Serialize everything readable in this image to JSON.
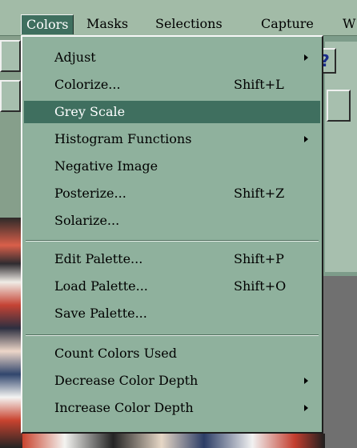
{
  "menubar": {
    "items": [
      {
        "label": "Colors"
      },
      {
        "label": "Masks"
      },
      {
        "label": "Selections"
      },
      {
        "label": "Capture"
      },
      {
        "label": "W"
      }
    ]
  },
  "toolbar": {
    "help_label": "?"
  },
  "dropdown": {
    "items": [
      {
        "label": "Adjust",
        "shortcut": "",
        "submenu": true
      },
      {
        "label": "Colorize...",
        "shortcut": "Shift+L",
        "submenu": false
      },
      {
        "label": "Grey Scale",
        "shortcut": "",
        "submenu": false,
        "highlighted": true
      },
      {
        "label": "Histogram Functions",
        "shortcut": "",
        "submenu": true
      },
      {
        "label": "Negative Image",
        "shortcut": "",
        "submenu": false
      },
      {
        "label": "Posterize...",
        "shortcut": "Shift+Z",
        "submenu": false
      },
      {
        "label": "Solarize...",
        "shortcut": "",
        "submenu": false
      },
      {
        "label": "Edit Palette...",
        "shortcut": "Shift+P",
        "submenu": false
      },
      {
        "label": "Load Palette...",
        "shortcut": "Shift+O",
        "submenu": false
      },
      {
        "label": "Save Palette...",
        "shortcut": "",
        "submenu": false
      },
      {
        "label": "Count Colors Used",
        "shortcut": "",
        "submenu": false
      },
      {
        "label": "Decrease Color Depth",
        "shortcut": "",
        "submenu": true
      },
      {
        "label": "Increase Color Depth",
        "shortcut": "",
        "submenu": true
      }
    ]
  },
  "colors": {
    "menu_bg": "#8fb19d",
    "highlight": "#3f6f5f",
    "help_icon": "#1a2d8b"
  }
}
